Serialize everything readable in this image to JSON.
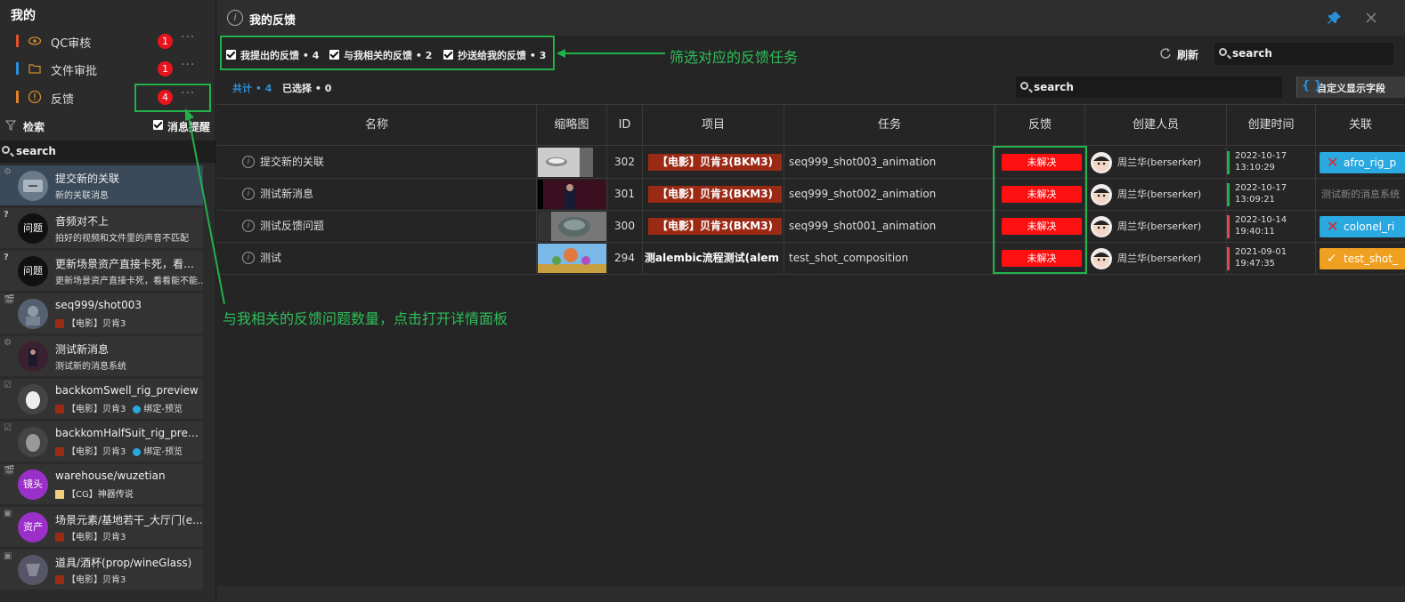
{
  "sidebar": {
    "title": "我的",
    "categories": [
      {
        "label": "QC审核",
        "badge": "1",
        "more": "···",
        "bar": "#e0522d",
        "icon": "eye-icon"
      },
      {
        "label": "文件审批",
        "badge": "1",
        "more": "···",
        "bar": "#2a8fd8",
        "icon": "folder-icon"
      },
      {
        "label": "反馈",
        "badge": "4",
        "more": "···",
        "bar": "#e0802d",
        "icon": "alert-icon"
      }
    ],
    "filter_label": "检索",
    "remind_label": "消息提醒",
    "search_placeholder": "search",
    "items": [
      {
        "title": "提交新的关联",
        "sub": "新的关联消息",
        "corner": "⚙"
      },
      {
        "title": "音频对不上",
        "sub": "拍好的视频和文件里的声音不匹配",
        "corner": "?",
        "avatar_text": "问题"
      },
      {
        "title": "更新场景资产直接卡死，看看...",
        "sub": "更新场景资产直接卡死，看看能不能...",
        "corner": "?",
        "avatar_text": "问题"
      },
      {
        "title": "seq999/shot003",
        "sub": "【电影】贝肯3",
        "corner": "🎬"
      },
      {
        "title": "测试新消息",
        "sub": "测试新的消息系统",
        "corner": "⚙"
      },
      {
        "title": "backkomSwell_rig_preview",
        "sub": "【电影】贝肯3",
        "sub2": "绑定-预览",
        "corner": "☑"
      },
      {
        "title": "backkomHalfSuit_rig_preview",
        "sub": "【电影】贝肯3",
        "sub2": "绑定-预览",
        "corner": "☑"
      },
      {
        "title": "warehouse/wuzetian",
        "sub": "【CG】神器传说",
        "corner": "🎬",
        "avatar_text": "镜头"
      },
      {
        "title": "场景元素/基地若干_大厅门(e...",
        "sub": "【电影】贝肯3",
        "corner": "▣",
        "avatar_text": "资产"
      },
      {
        "title": "道具/酒杯(prop/wineGlass)",
        "sub": "【电影】贝肯3",
        "corner": "▣"
      }
    ]
  },
  "main": {
    "title": "我的反馈",
    "filters": [
      "我提出的反馈 • 4",
      "与我相关的反馈 • 2",
      "抄送给我的反馈 • 3"
    ],
    "refresh": "刷新",
    "search_placeholder": "search",
    "total": "共计 • 4",
    "selected": "已选择 • 0",
    "table_search": "search",
    "custom_fields": "自定义显示字段",
    "columns": [
      "名称",
      "缩略图",
      "ID",
      "项目",
      "任务",
      "反馈",
      "创建人员",
      "创建时间",
      "关联"
    ],
    "rows": [
      {
        "name": "提交新的关联",
        "id": "302",
        "project": "【电影】贝肯3(BKM3)",
        "task": "seq999_shot003_animation",
        "feedback": "未解决",
        "creator": "周兰华(berserker)",
        "date": "2022-10-17",
        "time": "13:10:29",
        "relation": "afro_rig_p",
        "rel_color": "#2aa8e0",
        "line": "#22b24c"
      },
      {
        "name": "测试新消息",
        "id": "301",
        "project": "【电影】贝肯3(BKM3)",
        "task": "seq999_shot002_animation",
        "feedback": "未解决",
        "creator": "周兰华(berserker)",
        "date": "2022-10-17",
        "time": "13:09:21",
        "relation": "测试新的消息系统",
        "rel_color": "",
        "line": "#22b24c"
      },
      {
        "name": "测试反馈问题",
        "id": "300",
        "project": "【电影】贝肯3(BKM3)",
        "task": "seq999_shot001_animation",
        "feedback": "未解决",
        "creator": "周兰华(berserker)",
        "date": "2022-10-14",
        "time": "19:40:11",
        "relation": "colonel_ri",
        "rel_color": "#2aa8e0",
        "line": "#e04a4a"
      },
      {
        "name": "测试",
        "id": "294",
        "project": "测alembic流程测试(alembic",
        "task": "test_shot_composition",
        "feedback": "未解决",
        "creator": "周兰华(berserker)",
        "date": "2021-09-01",
        "time": "19:47:35",
        "relation": "test_shot_",
        "rel_color": "#f0a020",
        "line": "#e04a4a"
      }
    ]
  },
  "annotations": {
    "filter_note": "筛选对应的反馈任务",
    "badge_note": "与我相关的反馈问题数量，点击打开详情面板"
  },
  "colors": {
    "accent": "#2a8fd8",
    "annotation": "#22b24c",
    "unresolved": "#ff1010",
    "project": "#9b2a15"
  }
}
